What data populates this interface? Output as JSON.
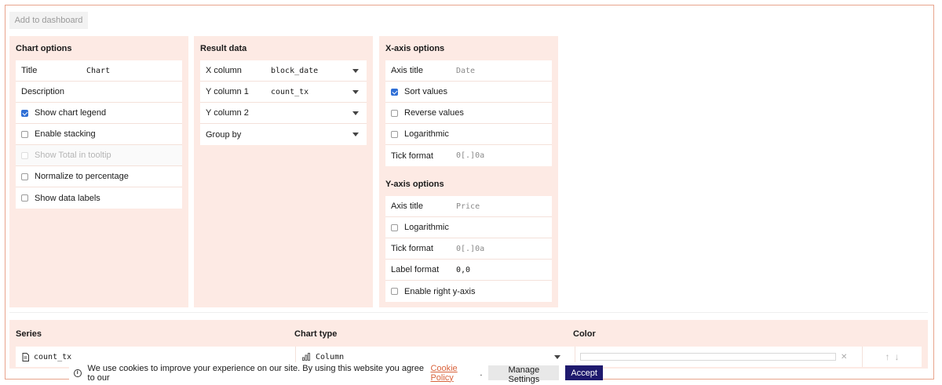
{
  "toolbar": {
    "add_to_dashboard": "Add to dashboard"
  },
  "chart_options": {
    "title": "Chart options",
    "title_label": "Title",
    "title_value": "Chart",
    "description_label": "Description",
    "show_chart_legend": "Show chart legend",
    "enable_stacking": "Enable stacking",
    "show_total_tooltip": "Show Total in tooltip",
    "normalize_percentage": "Normalize to percentage",
    "show_data_labels": "Show data labels"
  },
  "result_data": {
    "title": "Result data",
    "x_column_label": "X column",
    "x_column_value": "block_date",
    "y_column1_label": "Y column 1",
    "y_column1_value": "count_tx",
    "y_column2_label": "Y column 2",
    "y_column2_value": "",
    "group_by_label": "Group by",
    "group_by_value": ""
  },
  "x_axis": {
    "title": "X-axis options",
    "axis_title_label": "Axis title",
    "axis_title_placeholder": "Date",
    "sort_values": "Sort values",
    "reverse_values": "Reverse values",
    "logarithmic": "Logarithmic",
    "tick_format_label": "Tick format",
    "tick_format_placeholder": "0[.]0a"
  },
  "y_axis": {
    "title": "Y-axis options",
    "axis_title_label": "Axis title",
    "axis_title_placeholder": "Price",
    "logarithmic": "Logarithmic",
    "tick_format_label": "Tick format",
    "tick_format_placeholder": "0[.]0a",
    "label_format_label": "Label format",
    "label_format_value": "0,0",
    "enable_right_axis": "Enable right y-axis"
  },
  "series": {
    "col_series": "Series",
    "col_chart_type": "Chart type",
    "col_color": "Color",
    "rows": [
      {
        "name": "count_tx",
        "chart_type": "Column"
      }
    ]
  },
  "cookie": {
    "text": "We use cookies to improve your experience on our site. By using this website you agree to our",
    "link": "Cookie Policy",
    "period": ".",
    "manage": "Manage Settings",
    "accept": "Accept"
  },
  "colors": {
    "panel_bg": "#fdeae4",
    "accent": "#2f6fd6",
    "accept_bg": "#1f1a6e",
    "link": "#d9633c"
  }
}
